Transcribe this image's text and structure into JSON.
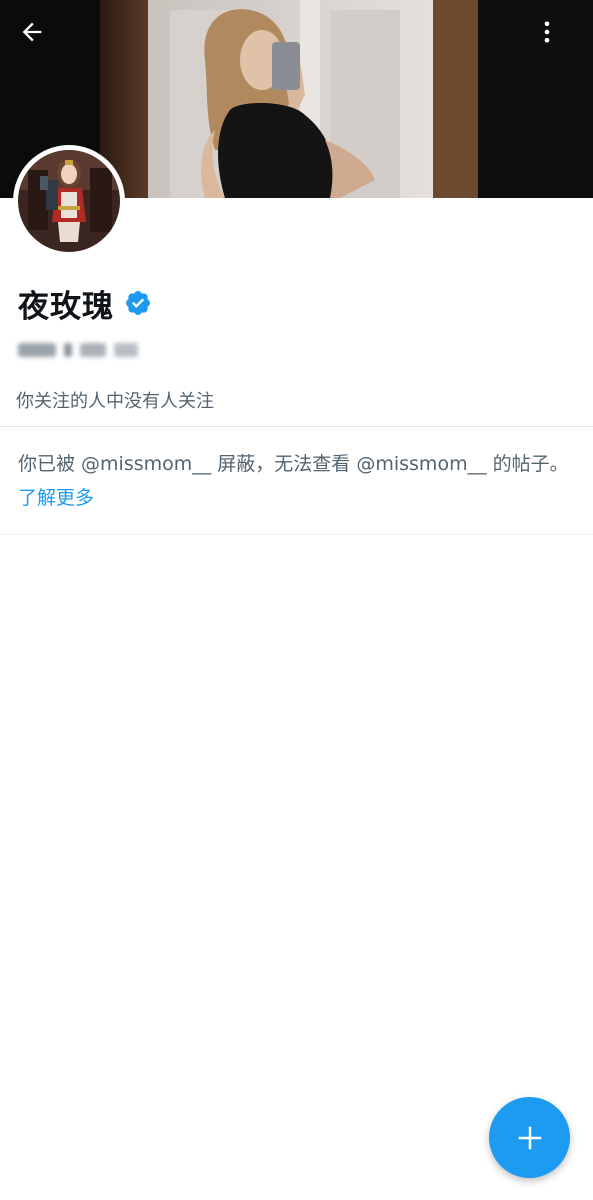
{
  "header": {
    "back_icon": "arrow-left-icon",
    "more_icon": "vertical-ellipsis-icon"
  },
  "profile": {
    "display_name": "夜玫瑰",
    "verified_icon": "verified-badge-icon",
    "handle": "@missmom__",
    "followers_note": "你关注的人中没有人关注"
  },
  "blocked_notice": {
    "text": "你已被 @missmom__ 屏蔽，无法查看 @missmom__ 的帖子。",
    "link_label": "了解更多"
  },
  "fab": {
    "icon": "plus-icon"
  },
  "colors": {
    "accent": "#1d9bf0",
    "text_primary": "#0f1419",
    "text_secondary": "#536471"
  }
}
